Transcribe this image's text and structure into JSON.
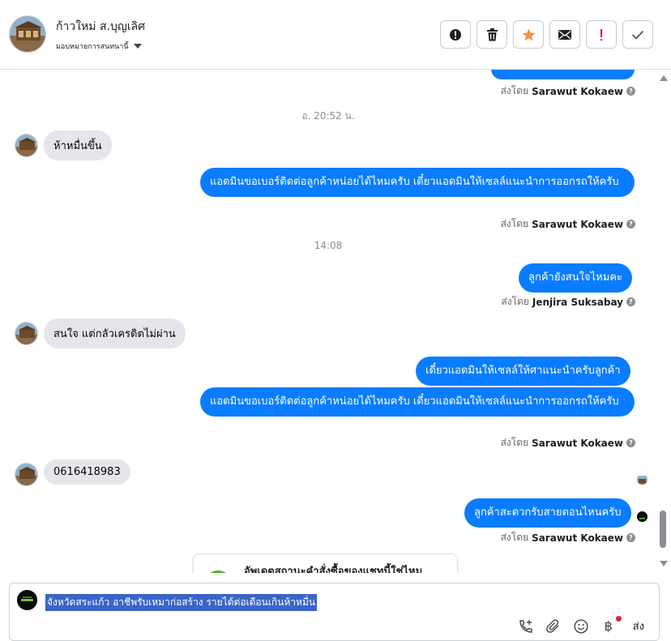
{
  "header": {
    "contact_name": "ก้าวใหม่ ส.บุญเลิศ",
    "assign_label": "มอบหมายการสนทนานี้",
    "actions": [
      {
        "icon": "alert-circle-icon",
        "label": "spam"
      },
      {
        "icon": "trash-icon",
        "label": "delete"
      },
      {
        "icon": "star-icon",
        "label": "star"
      },
      {
        "icon": "envelope-icon",
        "label": "mark-unread"
      },
      {
        "icon": "exclamation-icon",
        "label": "follow-up"
      },
      {
        "icon": "check-icon",
        "label": "done"
      }
    ],
    "star_color": "#f7923b",
    "exclaim_color": "#e41e3f"
  },
  "conversation": {
    "top_sentby": {
      "prefix": "ส่งโดย",
      "name": "Sarawut Kokaew"
    },
    "timestamps": [
      "อ. 20:52 น.",
      "14:08"
    ],
    "messages": [
      {
        "dir": "in",
        "text": "ห้าหมื่นขึ้น"
      },
      {
        "dir": "out",
        "text": "แอดมินขอเบอร์ติดต่อลูกค้าหน่อยได้ไหมครับ เดี๋ยวแอดมินให้เซลล์แนะนำการออกรถให้ครับ",
        "sent_by": "Sarawut Kokaew"
      },
      {
        "dir": "out",
        "text": "ลูกค้ายังสนใจไหมคะ",
        "sent_by": "Jenjira Suksabay"
      },
      {
        "dir": "in",
        "text": "สนใจ แต่กลัวเครดิตไม่ผ่าน"
      },
      {
        "dir": "out",
        "text": "เดี๋ยวแอดมินให้เซลล์ให้ศาแนะนำครับลูกค้า"
      },
      {
        "dir": "out",
        "text": "แอดมินขอเบอร์ติดต่อลูกค้าหน่อยได้ไหมครับ เดี๋ยวแอดมินให้เซลล์แนะนำการออกรถให้ครับ",
        "sent_by": "Sarawut Kokaew"
      },
      {
        "dir": "in",
        "text": "0616418983"
      },
      {
        "dir": "out",
        "text": "ลูกค้าสะดวกรับสายตอนไหนครับ",
        "sent_by": "Sarawut Kokaew"
      }
    ],
    "sentby_prefix": "ส่งโดย",
    "card_text": "อัพเดตสถานะคำสั่งซื้อของแชทนี้ใช่ไหม"
  },
  "composer": {
    "text": "จังหวัดสระแก้ว อาชีพรับเหมาก่อสร้าง รายได้ต่อเดือนเกินห้าหมื่น",
    "baht_symbol": "฿",
    "send_label": "ส่ง"
  },
  "colors": {
    "outgoing_bubble": "#0a7cff",
    "incoming_bubble": "#e4e6eb"
  }
}
